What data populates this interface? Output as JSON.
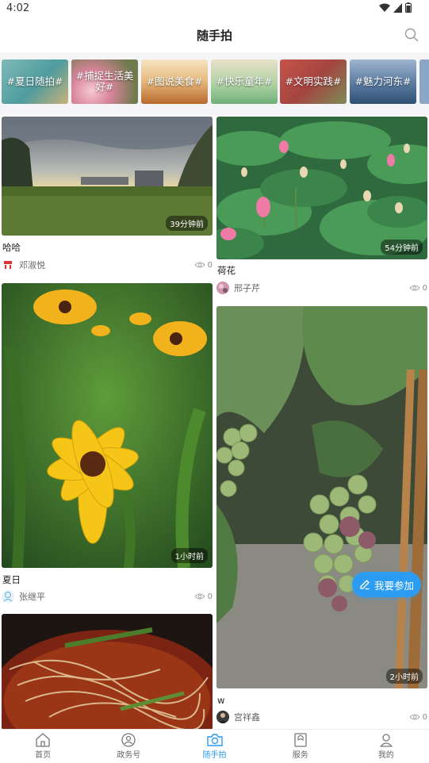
{
  "status_bar": {
    "time": "4:02"
  },
  "header": {
    "title": "随手拍"
  },
  "topics": [
    {
      "label": "#夏日随拍#"
    },
    {
      "label": "#捕捉生活美好#"
    },
    {
      "label": "#图说美食#"
    },
    {
      "label": "#快乐童年#"
    },
    {
      "label": "#文明实践#"
    },
    {
      "label": "#魅力河东#"
    }
  ],
  "posts": {
    "left": [
      {
        "title": "哈哈",
        "author": "邓淑悦",
        "views": "0",
        "time": "39分钟前"
      },
      {
        "title": "夏日",
        "author": "张继平",
        "views": "0",
        "time": "1小时前"
      }
    ],
    "right": [
      {
        "title": "荷花",
        "author": "邢子芹",
        "views": "0",
        "time": "54分钟前"
      },
      {
        "title": "w",
        "author": "宫祥鑫",
        "views": "0",
        "time": "2小时前"
      }
    ]
  },
  "fab": {
    "label": "我要参加"
  },
  "tabs": [
    {
      "label": "首页",
      "icon": "home-icon"
    },
    {
      "label": "政务号",
      "icon": "gov-icon"
    },
    {
      "label": "随手拍",
      "icon": "camera-icon",
      "active": true
    },
    {
      "label": "服务",
      "icon": "service-icon"
    },
    {
      "label": "我的",
      "icon": "profile-icon"
    }
  ],
  "colors": {
    "accent": "#2b9cf2"
  }
}
